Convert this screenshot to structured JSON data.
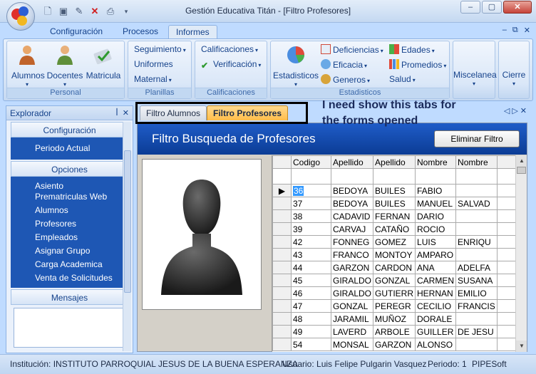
{
  "window": {
    "title": "Gestión Educativa Titán - [Filtro Profesores]"
  },
  "ribbon_tabs": [
    "Configuración",
    "Procesos",
    "Informes"
  ],
  "ribbon": {
    "personal": {
      "label": "Personal",
      "buttons": [
        "Alumnos",
        "Docentes",
        "Matricula"
      ]
    },
    "planillas": {
      "label": "Planillas",
      "items": [
        "Seguimiento",
        "Uniformes",
        "Maternal"
      ]
    },
    "calificaciones": {
      "label": "Calificaciones",
      "items": [
        "Calificaciones",
        "Verificación"
      ]
    },
    "estadisticos": {
      "label": "Estadisticos",
      "big": "Estadisticos",
      "items": [
        "Deficiencias",
        "Eficacia",
        "Generos",
        "Edades",
        "Promedios",
        "Salud"
      ]
    },
    "miscelanea": "Miscelanea",
    "cierre": "Cierre"
  },
  "explorer": {
    "title": "Explorador",
    "sections": {
      "configuracion": {
        "label": "Configuración",
        "items": [
          "Periodo Actual"
        ]
      },
      "opciones": {
        "label": "Opciones",
        "items": [
          "Asiento Prematriculas Web",
          "Alumnos",
          "Profesores",
          "Empleados",
          "Asignar Grupo",
          "Carga Academica",
          "Venta de Solicitudes"
        ]
      },
      "mensajes": {
        "label": "Mensajes"
      }
    }
  },
  "doc_tabs": [
    "Filtro Alumnos",
    "Filtro Profesores"
  ],
  "annotation": "I need show this tabs for the forms opened",
  "form": {
    "title": "Filtro Busqueda de Profesores",
    "clear_button": "Eliminar Filtro",
    "columns": [
      "Codigo",
      "Apellido",
      "Apellido",
      "Nombre",
      "Nombre"
    ],
    "rows": [
      [
        "36",
        "BEDOYA",
        "BUILES",
        "FABIO",
        ""
      ],
      [
        "37",
        "BEDOYA",
        "BUILES",
        "MANUEL",
        "SALVAD"
      ],
      [
        "38",
        "CADAVID",
        "FERNAN",
        "DARIO",
        ""
      ],
      [
        "39",
        "CARVAJ",
        "CATAÑO",
        "ROCIO",
        ""
      ],
      [
        "42",
        "FONNEG",
        "GOMEZ",
        "LUIS",
        "ENRIQU"
      ],
      [
        "43",
        "FRANCO",
        "MONTOY",
        "AMPARO",
        ""
      ],
      [
        "44",
        "GARZON",
        "CARDON",
        "ANA",
        "ADELFA"
      ],
      [
        "45",
        "GIRALDO",
        "GONZAL",
        "CARMEN",
        "SUSANA"
      ],
      [
        "46",
        "GIRALDO",
        "GUTIERR",
        "HERNAN",
        "EMILIO"
      ],
      [
        "47",
        "GONZAL",
        "PEREGR",
        "CECILIO",
        "FRANCIS"
      ],
      [
        "48",
        "JARAMIL",
        "MUÑOZ",
        "DORALE",
        ""
      ],
      [
        "49",
        "LAVERD",
        "ARBOLE",
        "GUILLER",
        "DE JESU"
      ],
      [
        "54",
        "MONSAL",
        "GARZON",
        "ALONSO",
        ""
      ]
    ]
  },
  "status": {
    "institucion": "Institución: INSTITUTO PARROQUIAL JESUS DE LA BUENA ESPERANZA",
    "usuario": "Usuario: Luis Felipe Pulgarin Vasquez",
    "periodo": "Periodo: 1",
    "vendor": "PIPESoft"
  }
}
